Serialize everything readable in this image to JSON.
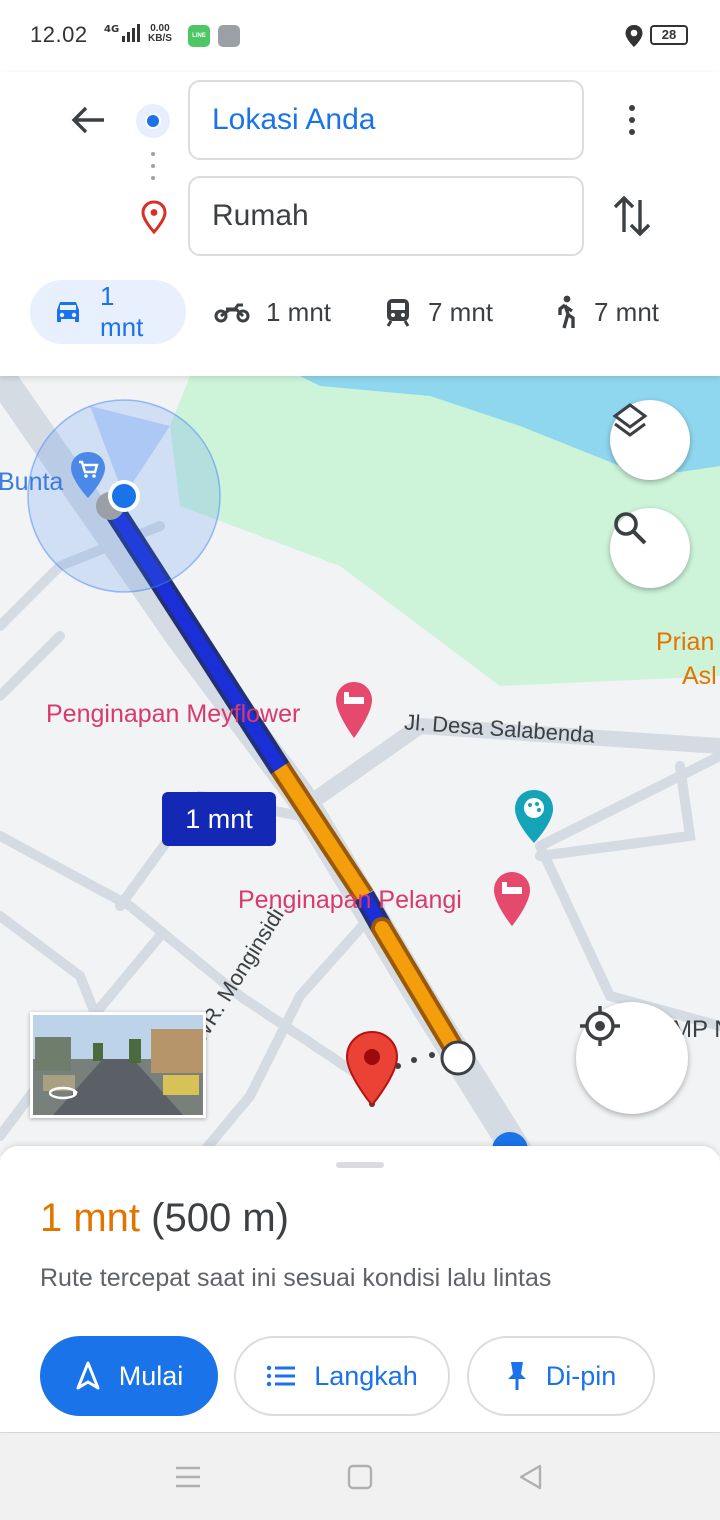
{
  "status_bar": {
    "time": "12.02",
    "network": "4G",
    "speed_value": "0.00",
    "speed_unit": "KB/S",
    "app_badge": "LINE",
    "battery": "28"
  },
  "directions": {
    "origin": "Lokasi Anda",
    "destination": "Rumah"
  },
  "modes": [
    {
      "mode": "car",
      "label": "1 mnt",
      "active": true
    },
    {
      "mode": "motorcycle",
      "label": "1 mnt",
      "active": false
    },
    {
      "mode": "transit",
      "label": "7 mnt",
      "active": false
    },
    {
      "mode": "walk",
      "label": "7 mnt",
      "active": false
    }
  ],
  "map": {
    "labels": {
      "buntu": "Bunta",
      "penginapan_meyflower": "Penginapan Meyflower",
      "jl_desa": "Jl. Desa Salabenda",
      "penginapan_pelangi": "Penginapan Pelangi",
      "wr_monginsidi": "WR. Monginsidi",
      "prian_1": "Prian",
      "prian_2": "Asl",
      "mp_n": "MP N"
    },
    "route_time": "1 mnt"
  },
  "sheet": {
    "time": "1 mnt",
    "distance": "(500 m)",
    "description": "Rute tercepat saat ini sesuai kondisi lalu lintas",
    "buttons": {
      "start": "Mulai",
      "steps": "Langkah",
      "pin": "Di-pin"
    }
  },
  "colors": {
    "accent": "#1a73e8",
    "route_blue": "#1a2fd8",
    "route_orange": "#f59e0b",
    "park_green": "#cdf3d9",
    "water": "#8fd7ef",
    "time_orange": "#e37400"
  }
}
